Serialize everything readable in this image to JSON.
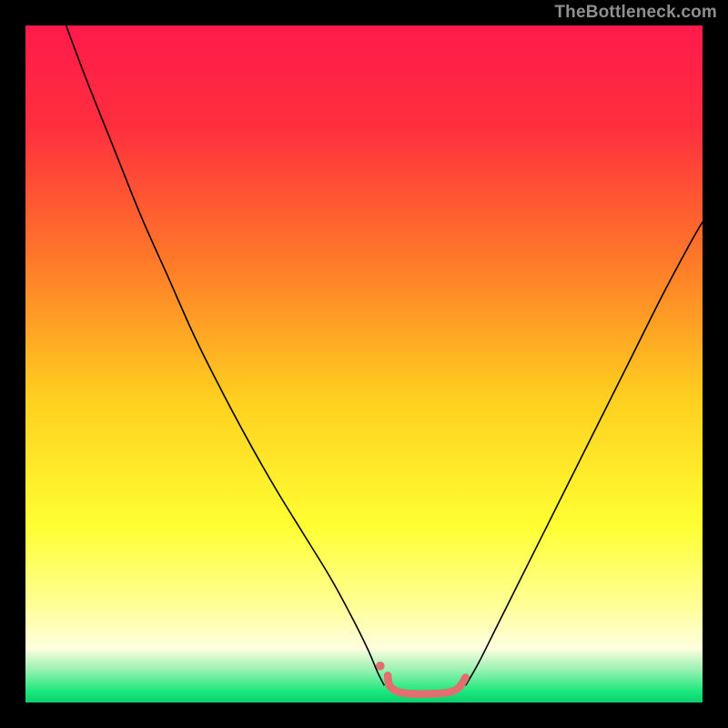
{
  "watermark": "TheBottleneck.com",
  "chart_data": {
    "type": "line",
    "title": "",
    "xlabel": "",
    "ylabel": "",
    "xlim": [
      0,
      100
    ],
    "ylim": [
      0,
      100
    ],
    "gradient_stops": [
      {
        "offset": 0.0,
        "color": "#ff1a4b"
      },
      {
        "offset": 0.15,
        "color": "#ff2f3e"
      },
      {
        "offset": 0.35,
        "color": "#ff7a29"
      },
      {
        "offset": 0.55,
        "color": "#ffcf1f"
      },
      {
        "offset": 0.74,
        "color": "#ffff33"
      },
      {
        "offset": 0.86,
        "color": "#ffff9a"
      },
      {
        "offset": 0.92,
        "color": "#fefedf"
      },
      {
        "offset": 0.95,
        "color": "#9ff2b5"
      },
      {
        "offset": 0.985,
        "color": "#17e77a"
      },
      {
        "offset": 1.0,
        "color": "#0ccf6e"
      }
    ],
    "series": [
      {
        "name": "left-curve",
        "color": "#000000",
        "width": 1.6,
        "points": [
          {
            "x": 6.0,
            "y": 100.0
          },
          {
            "x": 9.0,
            "y": 92.0
          },
          {
            "x": 13.0,
            "y": 82.0
          },
          {
            "x": 17.0,
            "y": 72.0
          },
          {
            "x": 21.0,
            "y": 63.0
          },
          {
            "x": 25.0,
            "y": 54.0
          },
          {
            "x": 29.0,
            "y": 46.0
          },
          {
            "x": 33.0,
            "y": 38.5
          },
          {
            "x": 37.0,
            "y": 31.5
          },
          {
            "x": 41.0,
            "y": 25.0
          },
          {
            "x": 45.0,
            "y": 18.5
          },
          {
            "x": 48.0,
            "y": 13.0
          },
          {
            "x": 50.5,
            "y": 8.0
          },
          {
            "x": 52.0,
            "y": 4.5
          },
          {
            "x": 53.0,
            "y": 2.5
          }
        ]
      },
      {
        "name": "right-curve",
        "color": "#000000",
        "width": 1.6,
        "points": [
          {
            "x": 65.0,
            "y": 2.5
          },
          {
            "x": 67.0,
            "y": 6.0
          },
          {
            "x": 70.0,
            "y": 12.0
          },
          {
            "x": 74.0,
            "y": 20.0
          },
          {
            "x": 78.0,
            "y": 28.0
          },
          {
            "x": 82.0,
            "y": 36.0
          },
          {
            "x": 86.0,
            "y": 44.0
          },
          {
            "x": 90.0,
            "y": 52.0
          },
          {
            "x": 94.0,
            "y": 60.0
          },
          {
            "x": 98.0,
            "y": 67.5
          },
          {
            "x": 100.0,
            "y": 71.0
          }
        ]
      },
      {
        "name": "bottom-marker",
        "color": "#e06f6d",
        "width": 8.5,
        "linecap": "round",
        "points": [
          {
            "x": 53.5,
            "y": 4.0
          },
          {
            "x": 53.8,
            "y": 2.5
          },
          {
            "x": 55.0,
            "y": 1.6
          },
          {
            "x": 57.0,
            "y": 1.3
          },
          {
            "x": 60.0,
            "y": 1.3
          },
          {
            "x": 62.5,
            "y": 1.5
          },
          {
            "x": 64.0,
            "y": 2.2
          },
          {
            "x": 65.0,
            "y": 3.7
          }
        ]
      },
      {
        "name": "bottom-marker-dot",
        "type": "scatter",
        "color": "#e06f6d",
        "radius": 4.8,
        "points": [
          {
            "x": 52.4,
            "y": 5.4
          }
        ]
      }
    ]
  }
}
